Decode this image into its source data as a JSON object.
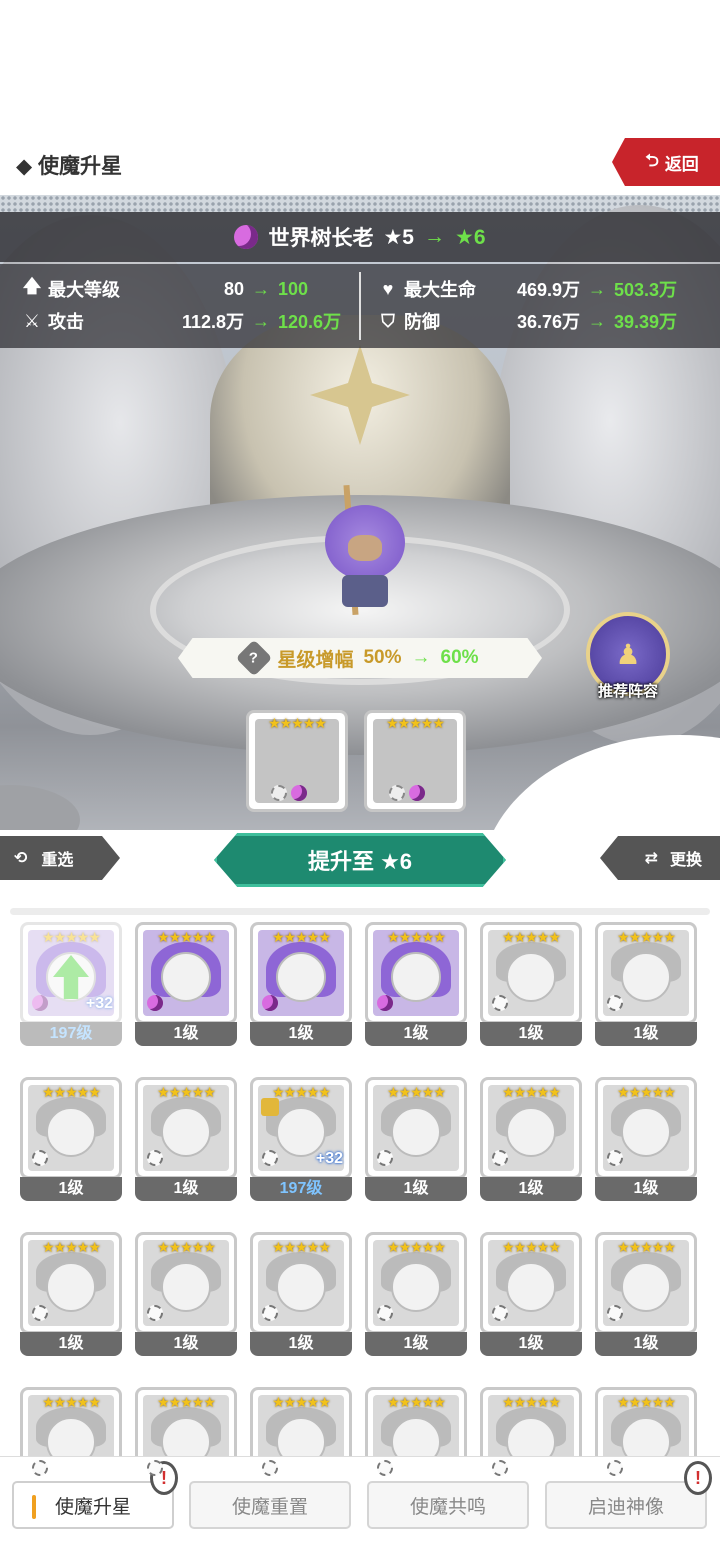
{
  "header": {
    "title": "◆ 使魔升星",
    "back_label": "返回"
  },
  "hero": {
    "name": "世界树长老",
    "star_from": "★5",
    "star_to": "★6",
    "arrow": "→"
  },
  "stats": {
    "max_level": {
      "label": "最大等级",
      "from": "80",
      "to": "100"
    },
    "attack": {
      "label": "攻击",
      "from": "112.8万",
      "to": "120.6万"
    },
    "max_hp": {
      "label": "最大生命",
      "from": "469.9万",
      "to": "503.3万"
    },
    "defense": {
      "label": "防御",
      "from": "36.76万",
      "to": "39.39万"
    }
  },
  "boost": {
    "badge": "?",
    "label": "星级增幅",
    "from": "50%",
    "to": "60%"
  },
  "recommend": {
    "label": "推荐阵容"
  },
  "material_slots": [
    {
      "stars": "★★★★★"
    },
    {
      "stars": "★★★★★"
    }
  ],
  "actions": {
    "reselect": "重选",
    "upgrade": "提升至 ★6",
    "swap": "更换"
  },
  "cards": [
    {
      "level": "197级",
      "plus": "+32",
      "kind": "purple",
      "faded": true,
      "arrow": true,
      "blue": true
    },
    {
      "level": "1级",
      "kind": "purple",
      "moon": true
    },
    {
      "level": "1级",
      "kind": "purple",
      "moon": true
    },
    {
      "level": "1级",
      "kind": "purple",
      "moon": true
    },
    {
      "level": "1级",
      "kind": "plain"
    },
    {
      "level": "1级",
      "kind": "plain"
    },
    {
      "level": "1级",
      "kind": "plain"
    },
    {
      "level": "1级",
      "kind": "plain"
    },
    {
      "level": "197级",
      "plus": "+32",
      "kind": "plain",
      "lock": true,
      "blue": true
    },
    {
      "level": "1级",
      "kind": "plain"
    },
    {
      "level": "1级",
      "kind": "plain"
    },
    {
      "level": "1级",
      "kind": "plain"
    },
    {
      "level": "1级",
      "kind": "plain"
    },
    {
      "level": "1级",
      "kind": "plain"
    },
    {
      "level": "1级",
      "kind": "plain"
    },
    {
      "level": "1级",
      "kind": "plain"
    },
    {
      "level": "1级",
      "kind": "plain"
    },
    {
      "level": "1级",
      "kind": "plain"
    },
    {
      "level": "",
      "kind": "plain"
    },
    {
      "level": "",
      "kind": "plain"
    },
    {
      "level": "",
      "kind": "plain"
    },
    {
      "level": "",
      "kind": "plain"
    },
    {
      "level": "",
      "kind": "plain"
    },
    {
      "level": "",
      "kind": "plain"
    }
  ],
  "card_stars": "★★★★★",
  "tabs": [
    {
      "label": "使魔升星",
      "active": true,
      "alert": "!"
    },
    {
      "label": "使魔重置"
    },
    {
      "label": "使魔共鸣"
    },
    {
      "label": "启迪神像",
      "alert": "!"
    }
  ]
}
